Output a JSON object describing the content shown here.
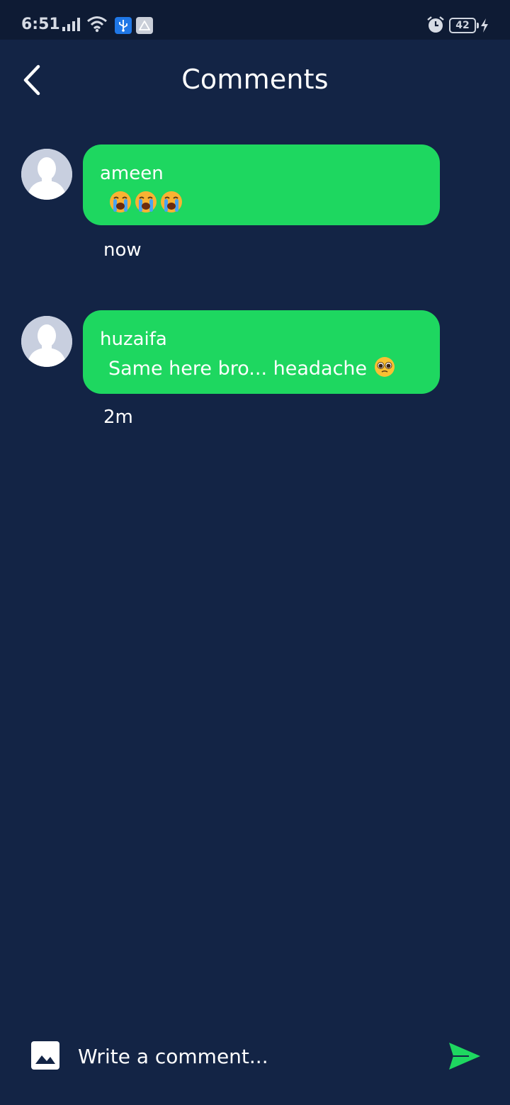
{
  "status_bar": {
    "time": "6:51",
    "battery": "42",
    "icons": [
      "signal-icon",
      "wifi-icon",
      "usb-icon",
      "drive-icon",
      "alarm-icon",
      "charging-icon"
    ]
  },
  "header": {
    "title": "Comments",
    "back_icon": "chevron-left-icon"
  },
  "comments": [
    {
      "author": "ameen",
      "text": "😭😭😭",
      "time": "now",
      "avatar_icon": "default-avatar-icon"
    },
    {
      "author": "huzaifa",
      "text": "Same here bro... headache 🥺",
      "time": "2m",
      "avatar_icon": "default-avatar-icon"
    }
  ],
  "composer": {
    "placeholder": "Write a comment...",
    "image_icon": "image-icon",
    "send_icon": "send-icon"
  },
  "colors": {
    "background": "#132445",
    "status_bar": "#0e1b34",
    "bubble": "#1ed760",
    "accent": "#1ed760",
    "text": "#ffffff"
  }
}
